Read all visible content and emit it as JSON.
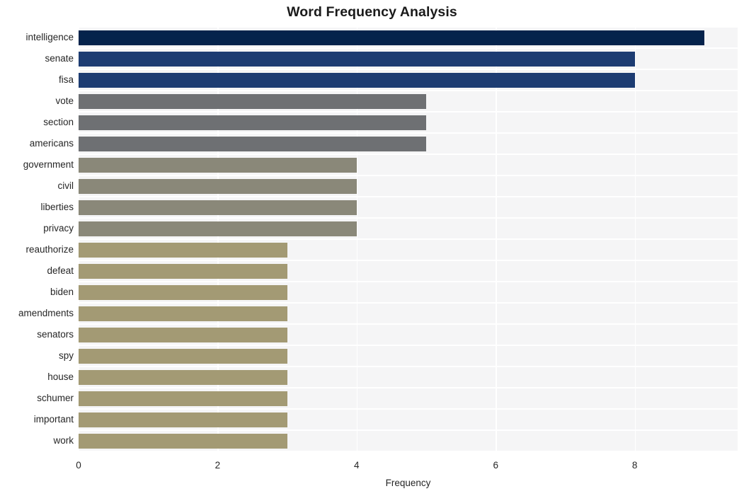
{
  "chart_data": {
    "type": "bar",
    "orientation": "horizontal",
    "title": "Word Frequency Analysis",
    "xlabel": "Frequency",
    "ylabel": "",
    "categories": [
      "intelligence",
      "senate",
      "fisa",
      "vote",
      "section",
      "americans",
      "government",
      "civil",
      "liberties",
      "privacy",
      "reauthorize",
      "defeat",
      "biden",
      "amendments",
      "senators",
      "spy",
      "house",
      "schumer",
      "important",
      "work"
    ],
    "values": [
      9,
      8,
      8,
      5,
      5,
      5,
      4,
      4,
      4,
      4,
      3,
      3,
      3,
      3,
      3,
      3,
      3,
      3,
      3,
      3
    ],
    "bar_colors": [
      "#05234c",
      "#1d3c72",
      "#1d3c72",
      "#6e7073",
      "#6e7073",
      "#6e7073",
      "#8a8879",
      "#8a8879",
      "#8a8879",
      "#8a8879",
      "#a39a74",
      "#a39a74",
      "#a39a74",
      "#a39a74",
      "#a39a74",
      "#a39a74",
      "#a39a74",
      "#a39a74",
      "#a39a74",
      "#a39a74"
    ],
    "xlim": [
      0,
      9.48
    ],
    "xticks": [
      0,
      2,
      4,
      6,
      8
    ],
    "xticklabels": [
      "0",
      "2",
      "4",
      "6",
      "8"
    ],
    "grid": true,
    "grid_axis": "both",
    "grid_color": "#ffffff",
    "plot_background": "#f5f5f6",
    "figure_background": "#ffffff",
    "legend": null
  }
}
